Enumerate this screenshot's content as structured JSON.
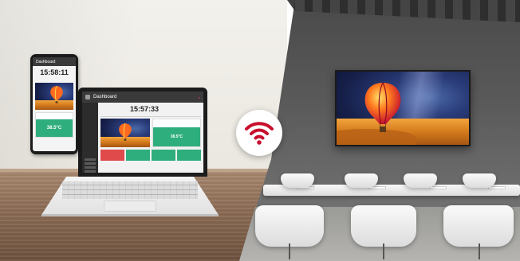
{
  "laptop_dashboard": {
    "title": "Dashboard",
    "time": "15:57:33",
    "temperature": "38.5°C"
  },
  "phone_dashboard": {
    "title": "Dashboard",
    "time": "15:58:11",
    "temperature": "38.5°C"
  },
  "colors": {
    "accent_green": "#2fae7d",
    "wifi_red": "#c8102e",
    "alert_red": "#e04a4a"
  },
  "icons": {
    "center": "wifi-icon"
  }
}
